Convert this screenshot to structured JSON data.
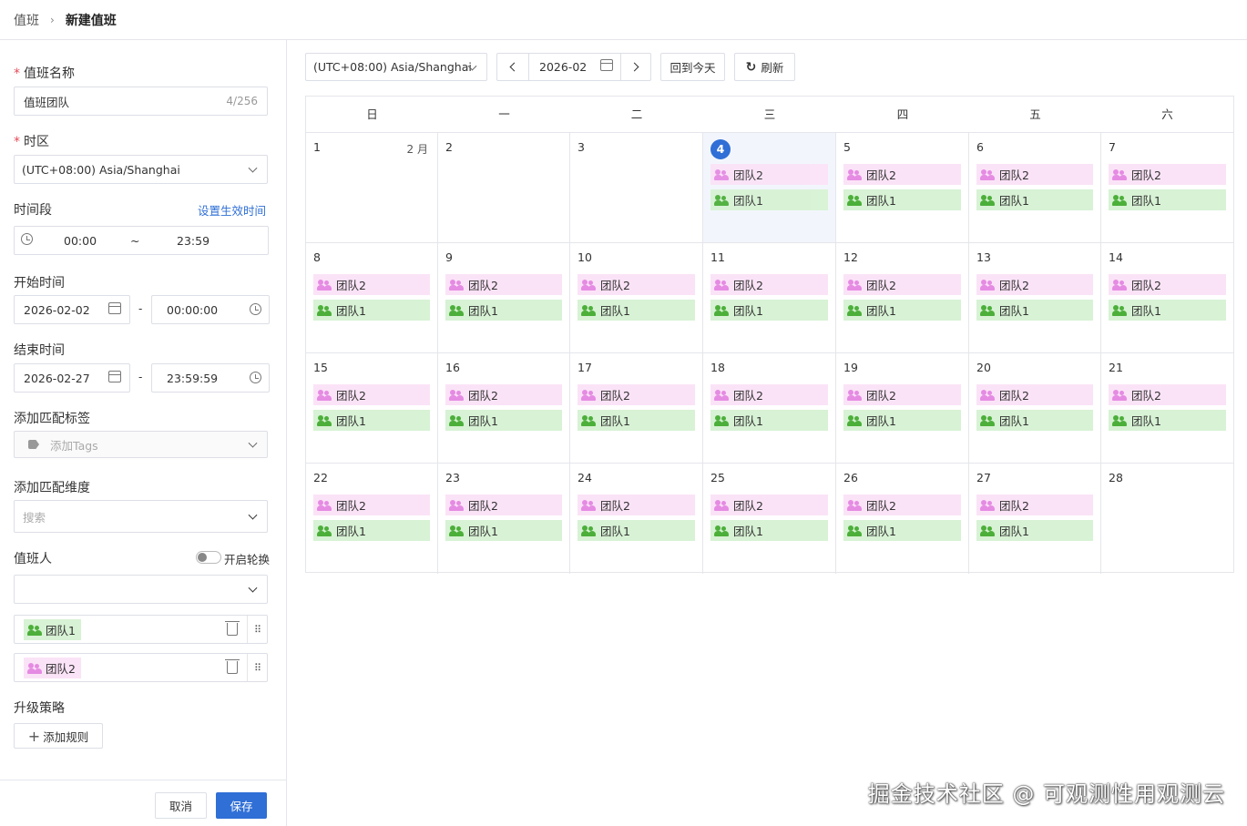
{
  "breadcrumb": {
    "parent": "值班",
    "separator": "›",
    "current": "新建值班"
  },
  "form": {
    "name": {
      "label": "值班名称",
      "required": "*",
      "value": "值班团队",
      "count": "4/256"
    },
    "timezone": {
      "label": "时区",
      "required": "*",
      "value": "(UTC+08:00) Asia/Shanghai"
    },
    "time_range": {
      "label": "时间段",
      "link": "设置生效时间",
      "start": "00:00",
      "separator": "~",
      "end": "23:59"
    },
    "start_time": {
      "label": "开始时间",
      "date": "2026-02-02",
      "dash": "-",
      "time": "00:00:00"
    },
    "end_time": {
      "label": "结束时间",
      "date": "2026-02-27",
      "dash": "-",
      "time": "23:59:59"
    },
    "tags": {
      "label": "添加匹配标签",
      "placeholder": "添加Tags"
    },
    "dimension": {
      "label": "添加匹配维度",
      "placeholder": "搜索"
    },
    "oncall": {
      "label": "值班人",
      "rotate_label": "开启轮换",
      "rotate_on": false,
      "select_value": "",
      "members": [
        {
          "name": "团队1",
          "color": "#4caf3a",
          "bg": "#d7f2d4"
        },
        {
          "name": "团队2",
          "color": "#e58be3",
          "bg": "#fbe3f7"
        }
      ]
    },
    "escalation": {
      "label": "升级策略",
      "add_button": "添加规则"
    },
    "cancel": "取消",
    "save": "保存"
  },
  "toolbar": {
    "timezone": "(UTC+08:00) Asia/Shanghai",
    "month": "2026-02",
    "today_button": "回到今天",
    "refresh_button": "刷新"
  },
  "calendar": {
    "weekdays": [
      "日",
      "一",
      "二",
      "三",
      "四",
      "五",
      "六"
    ],
    "month_label": "2 月",
    "today": 4,
    "team1": "团队1",
    "team2": "团队2",
    "colors": {
      "team1": "#4caf3a",
      "team1_bg": "#d7f2d4",
      "team2": "#e58be3",
      "team2_bg": "#fbe3f7",
      "today": "#2f6fd6"
    },
    "weeks": [
      [
        {
          "day": "1",
          "events": false
        },
        {
          "day": "2",
          "events": false
        },
        {
          "day": "3",
          "events": false
        },
        {
          "day": "4",
          "events": true
        },
        {
          "day": "5",
          "events": true
        },
        {
          "day": "6",
          "events": true
        },
        {
          "day": "7",
          "events": true
        }
      ],
      [
        {
          "day": "8",
          "events": true
        },
        {
          "day": "9",
          "events": true
        },
        {
          "day": "10",
          "events": true
        },
        {
          "day": "11",
          "events": true
        },
        {
          "day": "12",
          "events": true
        },
        {
          "day": "13",
          "events": true
        },
        {
          "day": "14",
          "events": true
        }
      ],
      [
        {
          "day": "15",
          "events": true
        },
        {
          "day": "16",
          "events": true
        },
        {
          "day": "17",
          "events": true
        },
        {
          "day": "18",
          "events": true
        },
        {
          "day": "19",
          "events": true
        },
        {
          "day": "20",
          "events": true
        },
        {
          "day": "21",
          "events": true
        }
      ],
      [
        {
          "day": "22",
          "events": true
        },
        {
          "day": "23",
          "events": true
        },
        {
          "day": "24",
          "events": true
        },
        {
          "day": "25",
          "events": true
        },
        {
          "day": "26",
          "events": true
        },
        {
          "day": "27",
          "events": true
        },
        {
          "day": "28",
          "events": false
        }
      ]
    ]
  },
  "watermark": "掘金技术社区 @ 可观测性用观测云"
}
